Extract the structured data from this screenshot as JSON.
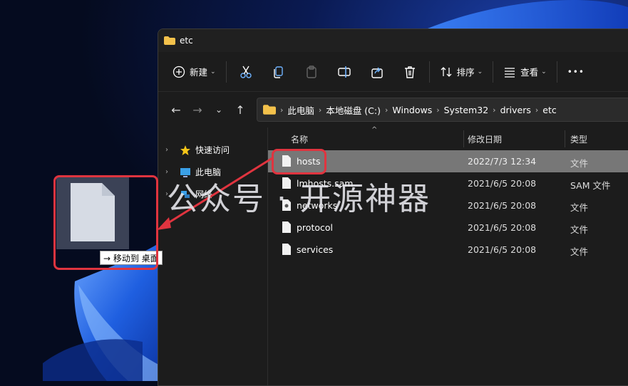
{
  "window": {
    "title": "etc"
  },
  "commandbar": {
    "new_label": "新建",
    "sort_label": "排序",
    "view_label": "查看",
    "more_label": "•••"
  },
  "address": {
    "crumbs": [
      "此电脑",
      "本地磁盘 (C:)",
      "Windows",
      "System32",
      "drivers",
      "etc"
    ]
  },
  "sidebar": {
    "items": [
      {
        "label": "快速访问"
      },
      {
        "label": "此电脑"
      },
      {
        "label": "网络"
      }
    ]
  },
  "columns": {
    "name": "名称",
    "modified": "修改日期",
    "type": "类型"
  },
  "files": [
    {
      "name": "hosts",
      "date": "2022/7/3 12:34",
      "type": "文件"
    },
    {
      "name": "lmhosts.sam",
      "date": "2021/6/5 20:08",
      "type": "SAM 文件"
    },
    {
      "name": "networks",
      "date": "2021/6/5 20:08",
      "type": "文件"
    },
    {
      "name": "protocol",
      "date": "2021/6/5 20:08",
      "type": "文件"
    },
    {
      "name": "services",
      "date": "2021/6/5 20:08",
      "type": "文件"
    }
  ],
  "drag": {
    "tooltip": "→ 移动到 桌面"
  },
  "watermark": "公众号 · 开源神器",
  "colors": {
    "highlight": "#e0343f",
    "selection": "#777777",
    "window_bg": "#1c1c1c"
  }
}
